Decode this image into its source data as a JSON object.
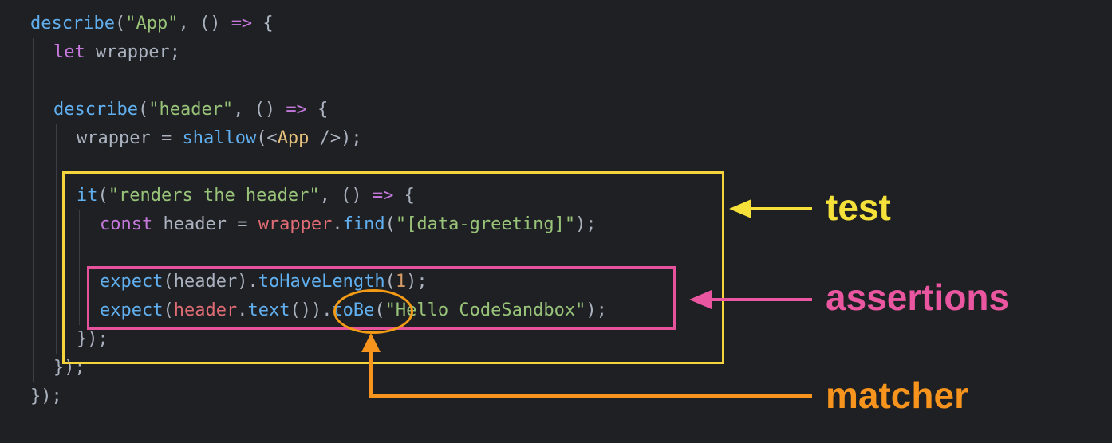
{
  "code": {
    "lines": [
      {
        "indent": 0,
        "tokens": [
          {
            "t": "describe",
            "c": "fn"
          },
          {
            "t": "(",
            "c": "punc"
          },
          {
            "t": "\"App\"",
            "c": "str"
          },
          {
            "t": ", () ",
            "c": "punc"
          },
          {
            "t": "=>",
            "c": "op"
          },
          {
            "t": " {",
            "c": "punc"
          }
        ]
      },
      {
        "indent": 1,
        "tokens": [
          {
            "t": "let",
            "c": "kw"
          },
          {
            "t": " wrapper;",
            "c": "var"
          }
        ]
      },
      {
        "indent": 0,
        "tokens": []
      },
      {
        "indent": 1,
        "tokens": [
          {
            "t": "describe",
            "c": "fn"
          },
          {
            "t": "(",
            "c": "punc"
          },
          {
            "t": "\"header\"",
            "c": "str"
          },
          {
            "t": ", () ",
            "c": "punc"
          },
          {
            "t": "=>",
            "c": "op"
          },
          {
            "t": " {",
            "c": "punc"
          }
        ]
      },
      {
        "indent": 2,
        "tokens": [
          {
            "t": "wrapper",
            "c": "var"
          },
          {
            "t": " = ",
            "c": "punc"
          },
          {
            "t": "shallow",
            "c": "fn"
          },
          {
            "t": "(<",
            "c": "punc"
          },
          {
            "t": "App",
            "c": "tag"
          },
          {
            "t": " />);",
            "c": "punc"
          }
        ]
      },
      {
        "indent": 0,
        "tokens": []
      },
      {
        "indent": 2,
        "tokens": [
          {
            "t": "it",
            "c": "fn"
          },
          {
            "t": "(",
            "c": "punc"
          },
          {
            "t": "\"renders the header\"",
            "c": "str"
          },
          {
            "t": ", () ",
            "c": "punc"
          },
          {
            "t": "=>",
            "c": "op"
          },
          {
            "t": " {",
            "c": "punc"
          }
        ]
      },
      {
        "indent": 3,
        "tokens": [
          {
            "t": "const",
            "c": "kw"
          },
          {
            "t": " header = ",
            "c": "var"
          },
          {
            "t": "wrapper",
            "c": "red"
          },
          {
            "t": ".",
            "c": "punc"
          },
          {
            "t": "find",
            "c": "fn"
          },
          {
            "t": "(",
            "c": "punc"
          },
          {
            "t": "\"[data-greeting]\"",
            "c": "str"
          },
          {
            "t": ");",
            "c": "punc"
          }
        ]
      },
      {
        "indent": 0,
        "tokens": []
      },
      {
        "indent": 3,
        "tokens": [
          {
            "t": "expect",
            "c": "fn"
          },
          {
            "t": "(header).",
            "c": "punc"
          },
          {
            "t": "toHaveLength",
            "c": "fn"
          },
          {
            "t": "(",
            "c": "punc"
          },
          {
            "t": "1",
            "c": "num"
          },
          {
            "t": ");",
            "c": "punc"
          }
        ]
      },
      {
        "indent": 3,
        "tokens": [
          {
            "t": "expect",
            "c": "fn"
          },
          {
            "t": "(",
            "c": "punc"
          },
          {
            "t": "header",
            "c": "red"
          },
          {
            "t": ".",
            "c": "punc"
          },
          {
            "t": "text",
            "c": "fn"
          },
          {
            "t": "()).",
            "c": "punc"
          },
          {
            "t": "toBe",
            "c": "fn"
          },
          {
            "t": "(",
            "c": "punc"
          },
          {
            "t": "\"Hello CodeSandbox\"",
            "c": "str"
          },
          {
            "t": ");",
            "c": "punc"
          }
        ]
      },
      {
        "indent": 2,
        "tokens": [
          {
            "t": "});",
            "c": "punc"
          }
        ]
      },
      {
        "indent": 1,
        "tokens": [
          {
            "t": "});",
            "c": "punc"
          }
        ]
      },
      {
        "indent": 0,
        "tokens": [
          {
            "t": "});",
            "c": "punc"
          }
        ]
      }
    ]
  },
  "annotations": {
    "test": {
      "label": "test",
      "color": "#f5d33c"
    },
    "assertions": {
      "label": "assertions",
      "color": "#e6539c"
    },
    "matcher": {
      "label": "matcher",
      "color": "#f39a16"
    }
  }
}
